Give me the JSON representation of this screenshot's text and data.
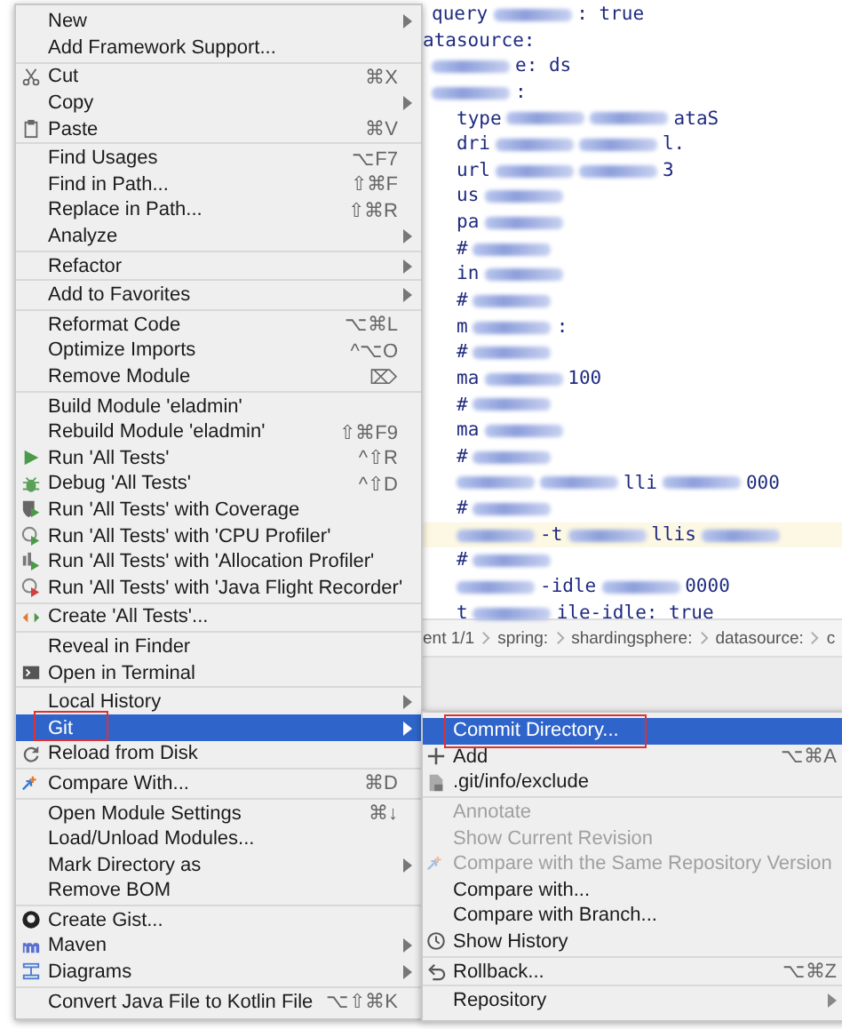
{
  "editor": {
    "lines": [
      {
        "highlighted": false,
        "segments": [
          {
            "kind": "text",
            "text": "query"
          },
          {
            "kind": "blur"
          },
          {
            "kind": "text",
            "text": ": true"
          }
        ]
      },
      {
        "highlighted": false,
        "segments": [
          {
            "kind": "text",
            "text": "atasource:"
          }
        ]
      },
      {
        "highlighted": false,
        "segments": [
          {
            "kind": "blur"
          },
          {
            "kind": "text",
            "text": "e: ds"
          }
        ]
      },
      {
        "highlighted": false,
        "segments": [
          {
            "kind": "blur"
          },
          {
            "kind": "text",
            "text": ":"
          }
        ]
      },
      {
        "highlighted": false,
        "segments": [
          {
            "kind": "text",
            "text": "type"
          },
          {
            "kind": "blur"
          },
          {
            "kind": "blur"
          },
          {
            "kind": "text",
            "text": "ataS"
          }
        ]
      },
      {
        "highlighted": false,
        "segments": [
          {
            "kind": "text",
            "text": "dri"
          },
          {
            "kind": "blur"
          },
          {
            "kind": "blur"
          },
          {
            "kind": "text",
            "text": "l."
          }
        ]
      },
      {
        "highlighted": false,
        "segments": [
          {
            "kind": "text",
            "text": "url"
          },
          {
            "kind": "blur"
          },
          {
            "kind": "blur"
          },
          {
            "kind": "text",
            "text": "3"
          }
        ]
      },
      {
        "highlighted": false,
        "segments": [
          {
            "kind": "text",
            "text": "us"
          },
          {
            "kind": "blur"
          }
        ]
      },
      {
        "highlighted": false,
        "segments": [
          {
            "kind": "text",
            "text": "pa"
          },
          {
            "kind": "blur"
          }
        ]
      },
      {
        "highlighted": false,
        "segments": [
          {
            "kind": "text",
            "text": "#"
          },
          {
            "kind": "blur"
          }
        ]
      },
      {
        "highlighted": false,
        "segments": [
          {
            "kind": "text",
            "text": "in"
          },
          {
            "kind": "blur"
          }
        ]
      },
      {
        "highlighted": false,
        "segments": [
          {
            "kind": "text",
            "text": "#"
          },
          {
            "kind": "blur"
          }
        ]
      },
      {
        "highlighted": false,
        "segments": [
          {
            "kind": "text",
            "text": "m"
          },
          {
            "kind": "blur"
          },
          {
            "kind": "text",
            "text": ":"
          }
        ]
      },
      {
        "highlighted": false,
        "segments": [
          {
            "kind": "text",
            "text": "#"
          },
          {
            "kind": "blur"
          }
        ]
      },
      {
        "highlighted": false,
        "segments": [
          {
            "kind": "text",
            "text": "ma"
          },
          {
            "kind": "blur"
          },
          {
            "kind": "text",
            "text": "100"
          }
        ]
      },
      {
        "highlighted": false,
        "segments": [
          {
            "kind": "text",
            "text": "#"
          },
          {
            "kind": "blur"
          }
        ]
      },
      {
        "highlighted": false,
        "segments": [
          {
            "kind": "text",
            "text": "ma"
          },
          {
            "kind": "blur"
          }
        ]
      },
      {
        "highlighted": false,
        "segments": [
          {
            "kind": "text",
            "text": "#"
          },
          {
            "kind": "blur"
          }
        ]
      },
      {
        "highlighted": false,
        "segments": [
          {
            "kind": "blur"
          },
          {
            "kind": "blur"
          },
          {
            "kind": "text",
            "text": "lli"
          },
          {
            "kind": "blur"
          },
          {
            "kind": "text",
            "text": "000"
          }
        ]
      },
      {
        "highlighted": false,
        "segments": [
          {
            "kind": "text",
            "text": "#"
          },
          {
            "kind": "blur"
          }
        ]
      },
      {
        "highlighted": true,
        "segments": [
          {
            "kind": "blur"
          },
          {
            "kind": "text",
            "text": "-t"
          },
          {
            "kind": "blur"
          },
          {
            "kind": "text",
            "text": "llis"
          },
          {
            "kind": "blur"
          }
        ]
      },
      {
        "highlighted": false,
        "segments": [
          {
            "kind": "text",
            "text": "#"
          },
          {
            "kind": "blur"
          }
        ]
      },
      {
        "highlighted": false,
        "segments": [
          {
            "kind": "blur"
          },
          {
            "kind": "text",
            "text": "-idle"
          },
          {
            "kind": "blur"
          },
          {
            "kind": "text",
            "text": "0000"
          }
        ]
      },
      {
        "highlighted": false,
        "segments": [
          {
            "kind": "text",
            "text": "t"
          },
          {
            "kind": "blur"
          },
          {
            "kind": "text",
            "text": "ile-idle: true"
          }
        ]
      }
    ]
  },
  "breadcrumbs": [
    "ent 1/1",
    "spring:",
    "shardingsphere:",
    "datasource:",
    "c"
  ],
  "context_menu": {
    "groups": [
      [
        {
          "label": "New",
          "submenu": true,
          "selected": false,
          "marked": false
        },
        {
          "label": "Add Framework Support...",
          "submenu": false,
          "selected": false,
          "marked": false
        }
      ],
      [
        {
          "label": "Cut",
          "shortcut": "⌘X",
          "submenu": false,
          "selected": false,
          "marked": false
        },
        {
          "label": "Copy",
          "submenu": true,
          "selected": false,
          "marked": false
        },
        {
          "label": "Paste",
          "shortcut": "⌘V",
          "submenu": false,
          "selected": false,
          "marked": false
        }
      ],
      [
        {
          "label": "Find Usages",
          "shortcut": "⌥F7",
          "submenu": false,
          "selected": false,
          "marked": false
        },
        {
          "label": "Find in Path...",
          "shortcut": "⇧⌘F",
          "submenu": false,
          "selected": false,
          "marked": false
        },
        {
          "label": "Replace in Path...",
          "shortcut": "⇧⌘R",
          "submenu": false,
          "selected": false,
          "marked": false
        },
        {
          "label": "Analyze",
          "submenu": true,
          "selected": false,
          "marked": false
        }
      ],
      [
        {
          "label": "Refactor",
          "submenu": true,
          "selected": false,
          "marked": false
        }
      ],
      [
        {
          "label": "Add to Favorites",
          "submenu": true,
          "selected": false,
          "marked": false
        }
      ],
      [
        {
          "label": "Reformat Code",
          "shortcut": "⌥⌘L",
          "submenu": false,
          "selected": false,
          "marked": false
        },
        {
          "label": "Optimize Imports",
          "shortcut": "^⌥O",
          "submenu": false,
          "selected": false,
          "marked": false
        },
        {
          "label": "Remove Module",
          "shortcut": "⌦",
          "submenu": false,
          "selected": false,
          "marked": false
        }
      ],
      [
        {
          "label": "Build Module 'eladmin'",
          "submenu": false,
          "selected": false,
          "marked": false
        },
        {
          "label": "Rebuild Module 'eladmin'",
          "shortcut": "⇧⌘F9",
          "submenu": false,
          "selected": false,
          "marked": false
        },
        {
          "label": "Run 'All Tests'",
          "shortcut": "^⇧R",
          "submenu": false,
          "selected": false,
          "marked": false
        },
        {
          "label": "Debug 'All Tests'",
          "shortcut": "^⇧D",
          "submenu": false,
          "selected": false,
          "marked": false
        },
        {
          "label": "Run 'All Tests' with Coverage",
          "submenu": false,
          "selected": false,
          "marked": false
        },
        {
          "label": "Run 'All Tests' with 'CPU Profiler'",
          "submenu": false,
          "selected": false,
          "marked": false
        },
        {
          "label": "Run 'All Tests' with 'Allocation Profiler'",
          "submenu": false,
          "selected": false,
          "marked": false
        },
        {
          "label": "Run 'All Tests' with 'Java Flight Recorder'",
          "submenu": false,
          "selected": false,
          "marked": false
        }
      ],
      [
        {
          "label": "Create 'All Tests'...",
          "submenu": false,
          "selected": false,
          "marked": false
        }
      ],
      [
        {
          "label": "Reveal in Finder",
          "submenu": false,
          "selected": false,
          "marked": false
        },
        {
          "label": "Open in Terminal",
          "submenu": false,
          "selected": false,
          "marked": false
        }
      ],
      [
        {
          "label": "Local History",
          "submenu": true,
          "selected": false,
          "marked": false
        },
        {
          "label": "Git",
          "submenu": true,
          "selected": true,
          "marked": true
        },
        {
          "label": "Reload from Disk",
          "submenu": false,
          "selected": false,
          "marked": false
        }
      ],
      [
        {
          "label": "Compare With...",
          "shortcut": "⌘D",
          "submenu": false,
          "selected": false,
          "marked": false
        }
      ],
      [
        {
          "label": "Open Module Settings",
          "shortcut": "⌘↓",
          "submenu": false,
          "selected": false,
          "marked": false
        },
        {
          "label": "Load/Unload Modules...",
          "submenu": false,
          "selected": false,
          "marked": false
        },
        {
          "label": "Mark Directory as",
          "submenu": true,
          "selected": false,
          "marked": false
        },
        {
          "label": "Remove BOM",
          "submenu": false,
          "selected": false,
          "marked": false
        }
      ],
      [
        {
          "label": "Create Gist...",
          "submenu": false,
          "selected": false,
          "marked": false
        },
        {
          "label": "Maven",
          "submenu": true,
          "selected": false,
          "marked": false
        },
        {
          "label": "Diagrams",
          "submenu": true,
          "selected": false,
          "marked": false
        }
      ],
      [
        {
          "label": "Convert Java File to Kotlin File",
          "shortcut": "⌥⇧⌘K",
          "submenu": false,
          "selected": false,
          "marked": false
        }
      ]
    ]
  },
  "git_submenu": {
    "groups": [
      [
        {
          "label": "Commit Directory...",
          "submenu": false,
          "selected": true,
          "marked": true,
          "disabled": false
        },
        {
          "label": "Add",
          "shortcut": "⌥⌘A",
          "submenu": false,
          "selected": false,
          "marked": false,
          "disabled": false
        },
        {
          "label": ".git/info/exclude",
          "submenu": false,
          "selected": false,
          "marked": false,
          "disabled": false
        }
      ],
      [
        {
          "label": "Annotate",
          "submenu": false,
          "selected": false,
          "marked": false,
          "disabled": true
        },
        {
          "label": "Show Current Revision",
          "submenu": false,
          "selected": false,
          "marked": false,
          "disabled": true
        },
        {
          "label": "Compare with the Same Repository Version",
          "submenu": false,
          "selected": false,
          "marked": false,
          "disabled": true
        },
        {
          "label": "Compare with...",
          "submenu": false,
          "selected": false,
          "marked": false,
          "disabled": false
        },
        {
          "label": "Compare with Branch...",
          "submenu": false,
          "selected": false,
          "marked": false,
          "disabled": false
        },
        {
          "label": "Show History",
          "submenu": false,
          "selected": false,
          "marked": false,
          "disabled": false
        }
      ],
      [
        {
          "label": "Rollback...",
          "shortcut": "⌥⌘Z",
          "submenu": false,
          "selected": false,
          "marked": false,
          "disabled": false
        }
      ],
      [
        {
          "label": "Repository",
          "submenu": true,
          "selected": false,
          "marked": false,
          "disabled": false
        }
      ]
    ]
  }
}
